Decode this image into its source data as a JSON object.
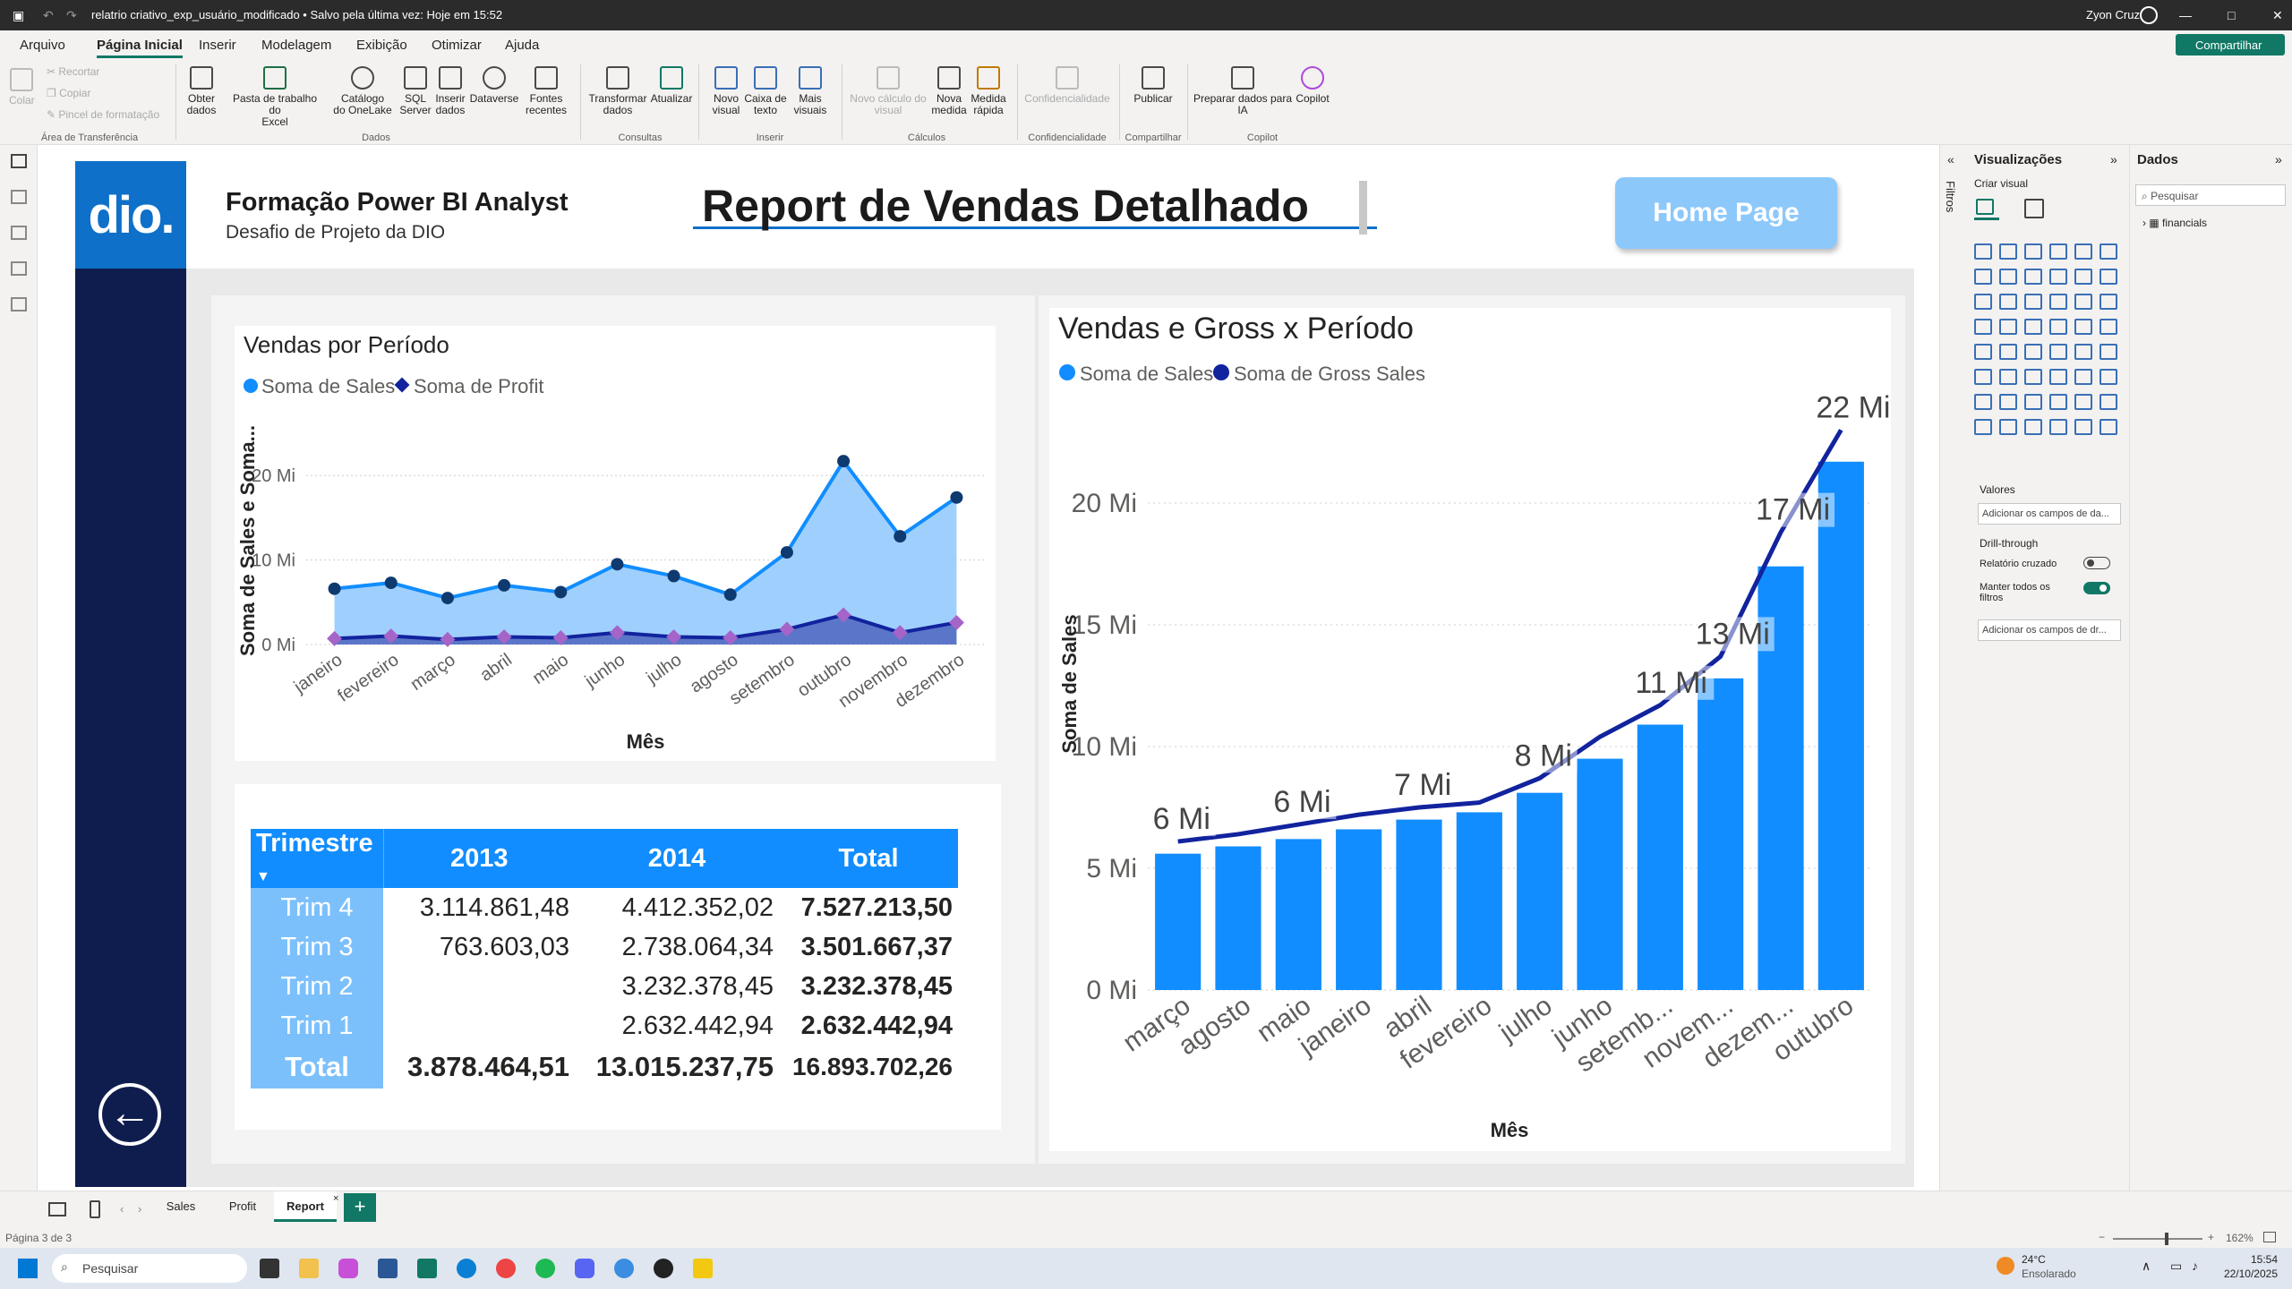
{
  "titlebar": {
    "file": "relatrio criativo_exp_usuário_modificado • Salvo pela última vez: Hoje em 15:52",
    "user": "Zyon Cruz",
    "share": "Compartilhar"
  },
  "menu": [
    "Arquivo",
    "Página Inicial",
    "Inserir",
    "Modelagem",
    "Exibição",
    "Otimizar",
    "Ajuda"
  ],
  "ribbon": {
    "clipboard": {
      "paste": "Colar",
      "cut": "Recortar",
      "copy": "Copiar",
      "format": "Pincel de formatação",
      "group": "Área de Transferência"
    },
    "data": [
      {
        "l1": "Obter",
        "l2": "dados"
      },
      {
        "l1": "Pasta de trabalho do",
        "l2": "Excel"
      },
      {
        "l1": "Catálogo",
        "l2": "do OneLake"
      },
      {
        "l1": "SQL",
        "l2": "Server"
      },
      {
        "l1": "Inserir",
        "l2": "dados"
      },
      {
        "l1": "Dataverse",
        "l2": ""
      },
      {
        "l1": "Fontes",
        "l2": "recentes"
      }
    ],
    "data_group": "Dados",
    "queries": [
      {
        "l1": "Transformar",
        "l2": "dados"
      },
      {
        "l1": "Atualizar",
        "l2": ""
      }
    ],
    "queries_group": "Consultas",
    "insert": [
      {
        "l1": "Novo",
        "l2": "visual"
      },
      {
        "l1": "Caixa de",
        "l2": "texto"
      },
      {
        "l1": "Mais",
        "l2": "visuais"
      }
    ],
    "insert_group": "Inserir",
    "calc": [
      {
        "l1": "Novo cálculo do",
        "l2": "visual"
      },
      {
        "l1": "Nova",
        "l2": "medida"
      },
      {
        "l1": "Medida",
        "l2": "rápida"
      }
    ],
    "calc_group": "Cálculos",
    "sens": {
      "l1": "Confidencialidade",
      "group": "Confidencialidade"
    },
    "share": {
      "l1": "Publicar",
      "group": "Compartilhar"
    },
    "copilot": [
      {
        "l1": "Preparar dados para",
        "l2": "IA"
      },
      {
        "l1": "Copilot",
        "l2": ""
      }
    ],
    "copilot_group": "Copilot"
  },
  "report": {
    "logo": "dio.",
    "course_title": "Formação Power BI Analyst",
    "course_sub": "Desafio de Projeto da DIO",
    "main_title": "Report de Vendas Detalhado",
    "home_button": "Home Page"
  },
  "colors": {
    "sales": "#118dff",
    "profit": "#12239e",
    "gross": "#12239e",
    "accent": "#0e70c8",
    "header_blue": "#118dff"
  },
  "chart_data": [
    {
      "type": "area",
      "title": "Vendas por Período",
      "xlabel": "Mês",
      "ylabel": "Soma de Sales e Soma...",
      "legend": [
        "Soma de  Sales",
        "Soma de Profit"
      ],
      "categories": [
        "janeiro",
        "fevereiro",
        "março",
        "abril",
        "maio",
        "junho",
        "julho",
        "agosto",
        "setembro",
        "outubro",
        "novembro",
        "dezembro"
      ],
      "series": [
        {
          "name": "Soma de  Sales",
          "values": [
            6.6,
            7.3,
            5.5,
            7.0,
            6.2,
            9.5,
            8.1,
            5.9,
            10.9,
            21.7,
            12.8,
            17.4
          ]
        },
        {
          "name": "Soma de Profit",
          "values": [
            0.7,
            1.0,
            0.6,
            0.9,
            0.8,
            1.4,
            0.9,
            0.8,
            1.8,
            3.5,
            1.4,
            2.6
          ]
        }
      ],
      "yticks": [
        "0 Mi",
        "10 Mi",
        "20 Mi"
      ],
      "ylim": [
        0,
        25
      ],
      "grid": true,
      "legend_position": "top-left"
    },
    {
      "type": "bar",
      "title": "Vendas e Gross x Período",
      "xlabel": "Mês",
      "ylabel": "Soma de Sales",
      "legend": [
        "Soma de  Sales",
        "Soma de Gross Sales"
      ],
      "categories": [
        "março",
        "agosto",
        "maio",
        "janeiro",
        "abril",
        "fevereiro",
        "julho",
        "junho",
        "setemb...",
        "novem...",
        "dezem...",
        "outubro"
      ],
      "series": [
        {
          "name": "Soma de  Sales",
          "values": [
            5.6,
            5.9,
            6.2,
            6.6,
            7.0,
            7.3,
            8.1,
            9.5,
            10.9,
            12.8,
            17.4,
            21.7
          ]
        },
        {
          "name": "Soma de Gross Sales",
          "values": [
            6.1,
            6.4,
            6.8,
            7.2,
            7.5,
            7.7,
            8.7,
            10.4,
            11.7,
            13.7,
            18.8,
            23.0
          ]
        }
      ],
      "data_labels": [
        "6 Mi",
        "",
        "6 Mi",
        "",
        "7 Mi",
        "",
        "8 Mi",
        "",
        "11 Mi",
        "13 Mi",
        "17 Mi",
        "22 Mi"
      ],
      "yticks": [
        "0 Mi",
        "5 Mi",
        "10 Mi",
        "15 Mi",
        "20 Mi"
      ],
      "ylim": [
        0,
        25
      ],
      "grid": true,
      "legend_position": "top-left"
    }
  ],
  "matrix": {
    "headers": [
      "Trimestre",
      "2013",
      "2014",
      "Total"
    ],
    "rows": [
      {
        "label": "Trim 4",
        "c2013": "3.114.861,48",
        "c2014": "4.412.352,02",
        "total": "7.527.213,50"
      },
      {
        "label": "Trim 3",
        "c2013": "763.603,03",
        "c2014": "2.738.064,34",
        "total": "3.501.667,37"
      },
      {
        "label": "Trim 2",
        "c2013": "",
        "c2014": "3.232.378,45",
        "total": "3.232.378,45"
      },
      {
        "label": "Trim 1",
        "c2013": "",
        "c2014": "2.632.442,94",
        "total": "2.632.442,94"
      }
    ],
    "total": {
      "label": "Total",
      "c2013": "3.878.464,51",
      "c2014": "13.015.237,75",
      "total": "16.893.702,26"
    }
  },
  "filters_label": "Filtros",
  "viz_panel": {
    "title": "Visualizações",
    "build": "Criar visual",
    "values": "Valores",
    "values_placeholder": "Adicionar os campos de da...",
    "drill": "Drill-through",
    "cross": "Relatório cruzado",
    "keep": "Manter todos os filtros",
    "drill_placeholder": "Adicionar os campos de dr..."
  },
  "data_panel": {
    "title": "Dados",
    "search": "Pesquisar",
    "table": "financials"
  },
  "tabs": [
    "Sales",
    "Profit",
    "Report"
  ],
  "status": {
    "page": "Página 3 de 3",
    "zoom": "162%"
  },
  "taskbar": {
    "search": "Pesquisar",
    "temp": "24°C",
    "weather": "Ensolarado",
    "time": "15:54",
    "date": "22/10/2025"
  }
}
